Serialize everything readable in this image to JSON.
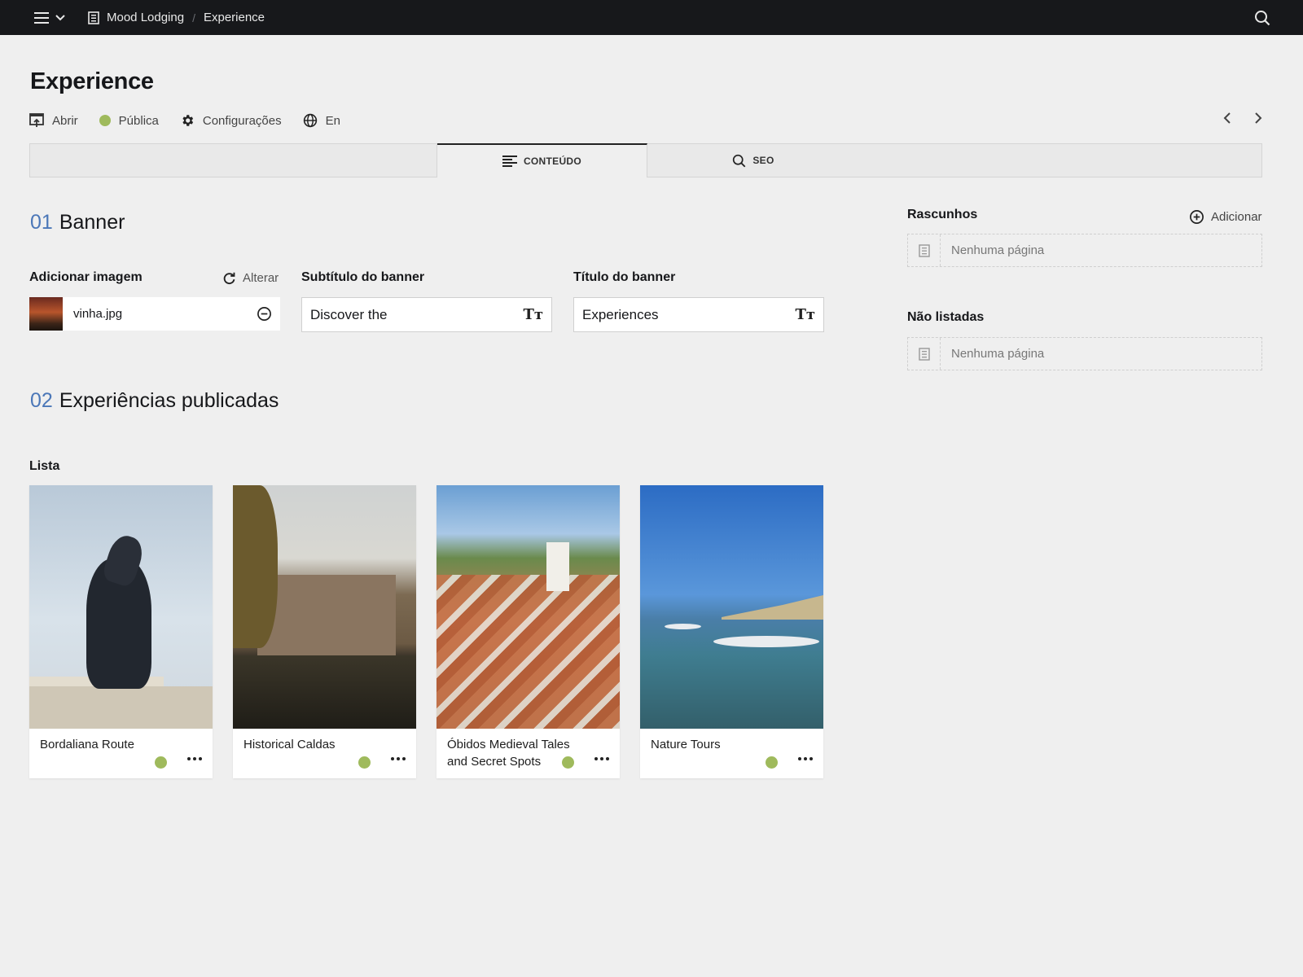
{
  "topbar": {
    "breadcrumbs": [
      "Mood Lodging",
      "Experience"
    ],
    "separator": "/"
  },
  "page": {
    "title": "Experience",
    "actions": {
      "open": "Abrir",
      "status": "Pública",
      "settings": "Configurações",
      "language": "En"
    }
  },
  "tabs": [
    {
      "label": "CONTEÚDO",
      "active": true,
      "icon": "align-left-icon"
    },
    {
      "label": "SEO",
      "active": false,
      "icon": "search-icon"
    }
  ],
  "sections": {
    "banner": {
      "number": "01",
      "title": "Banner",
      "image_label": "Adicionar imagem",
      "change_label": "Alterar",
      "image_file": "vinha.jpg",
      "subtitle_label": "Subtítulo do banner",
      "subtitle_value": "Discover the",
      "title_label": "Título do banner",
      "title_value": "Experiences"
    },
    "published": {
      "number": "02",
      "title": "Experiências publicadas",
      "list_label": "Lista"
    }
  },
  "cards": [
    {
      "title": "Bordaliana Route",
      "status_color": "#9fba5c"
    },
    {
      "title": "Historical Caldas",
      "status_color": "#9fba5c"
    },
    {
      "title": "Óbidos Medieval Tales and Secret Spots",
      "status_color": "#9fba5c"
    },
    {
      "title": "Nature Tours",
      "status_color": "#9fba5c"
    }
  ],
  "sidebar": {
    "drafts_label": "Rascunhos",
    "add_label": "Adicionar",
    "drafts_empty": "Nenhuma página",
    "unlisted_label": "Não listadas",
    "unlisted_empty": "Nenhuma página"
  },
  "colors": {
    "accent_number": "#4b77b8",
    "status_published": "#9fba5c",
    "topbar": "#17181b"
  }
}
